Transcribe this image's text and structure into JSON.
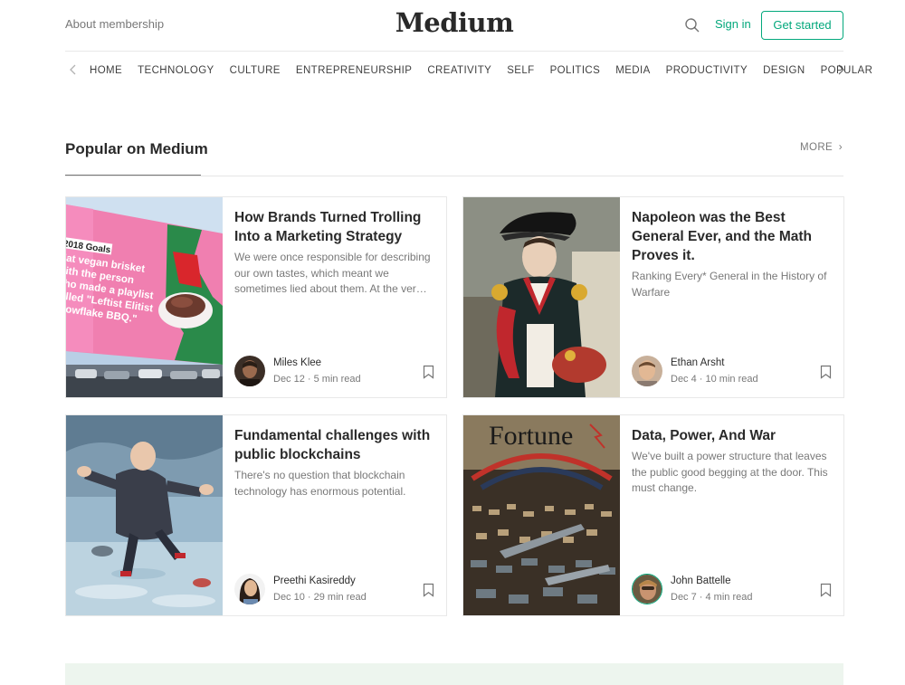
{
  "header": {
    "about": "About membership",
    "logo": "Medium",
    "signin": "Sign in",
    "get_started": "Get started",
    "search_icon": "search-icon"
  },
  "nav": {
    "items": [
      "HOME",
      "TECHNOLOGY",
      "CULTURE",
      "ENTREPRENEURSHIP",
      "CREATIVITY",
      "SELF",
      "POLITICS",
      "MEDIA",
      "PRODUCTIVITY",
      "DESIGN",
      "POPULAR"
    ]
  },
  "section": {
    "title": "Popular on Medium",
    "more": "MORE"
  },
  "cards": [
    {
      "title": "How Brands Turned Trolling Into a Marketing Strategy",
      "subtitle": "We were once responsible for describing our own tastes, which meant we sometimes lied about them. At the ver…",
      "author": "Miles Klee",
      "meta": "Dec 12 · 5 min read",
      "billboard": {
        "heading": "2018 Goals",
        "lines": [
          "Eat vegan brisket",
          "with the person",
          "who made a playlist",
          "called \"Leftist Elitist",
          "Snowflake BBQ.\""
        ]
      }
    },
    {
      "title": "Napoleon was the Best General Ever, and the Math Proves it.",
      "subtitle": "Ranking Every* General in the History of Warfare",
      "author": "Ethan Arsht",
      "meta": "Dec 4 · 10 min read"
    },
    {
      "title": "Fundamental challenges with public blockchains",
      "subtitle": "There's no question that blockchain technology has enormous potential.",
      "author": "Preethi Kasireddy",
      "meta": "Dec 10 · 29 min read"
    },
    {
      "title": "Data, Power, And War",
      "subtitle": "We've built a power structure that leaves the public good begging at the door. This must change.",
      "author": "John Battelle",
      "meta": "Dec 7 · 4 min read",
      "magazine": "Fortune"
    }
  ],
  "colors": {
    "accent": "#03a87c",
    "footer_band": "#edf5ee"
  }
}
